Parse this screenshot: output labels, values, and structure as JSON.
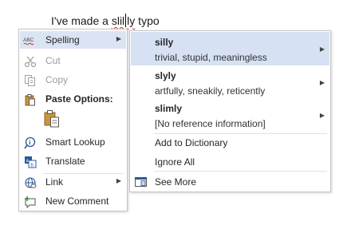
{
  "document": {
    "text_before": "I've made a ",
    "misspelled_part1": "slil",
    "misspelled_part2": "ly",
    "text_after": " typo"
  },
  "menu": {
    "items": [
      {
        "label": "Spelling",
        "icon": "abc-spelling-icon"
      },
      {
        "label": "Cut",
        "icon": "scissors-icon"
      },
      {
        "label": "Copy",
        "icon": "copy-icon"
      },
      {
        "label": "Paste Options:",
        "icon": "clipboard-icon"
      },
      {
        "label": "Smart Lookup",
        "icon": "smart-lookup-icon"
      },
      {
        "label": "Translate",
        "icon": "translate-icon"
      },
      {
        "label": "Link",
        "icon": "link-icon"
      },
      {
        "label": "New Comment",
        "icon": "new-comment-icon"
      }
    ]
  },
  "suggestions": [
    {
      "word": "silly",
      "description": "trivial, stupid, meaningless"
    },
    {
      "word": "slyly",
      "description": "artfully, sneakily, reticently"
    },
    {
      "word": "slimly",
      "description": "[No reference information]"
    }
  ],
  "actions": {
    "add_to_dictionary": "Add to Dictionary",
    "ignore_all": "Ignore All",
    "see_more": "See More"
  },
  "colors": {
    "highlight": "#dbe4f3",
    "suggestion_highlight": "#d6e1f3",
    "spelling_squiggle": "#d32f2f",
    "icon_blue": "#2b579a"
  }
}
